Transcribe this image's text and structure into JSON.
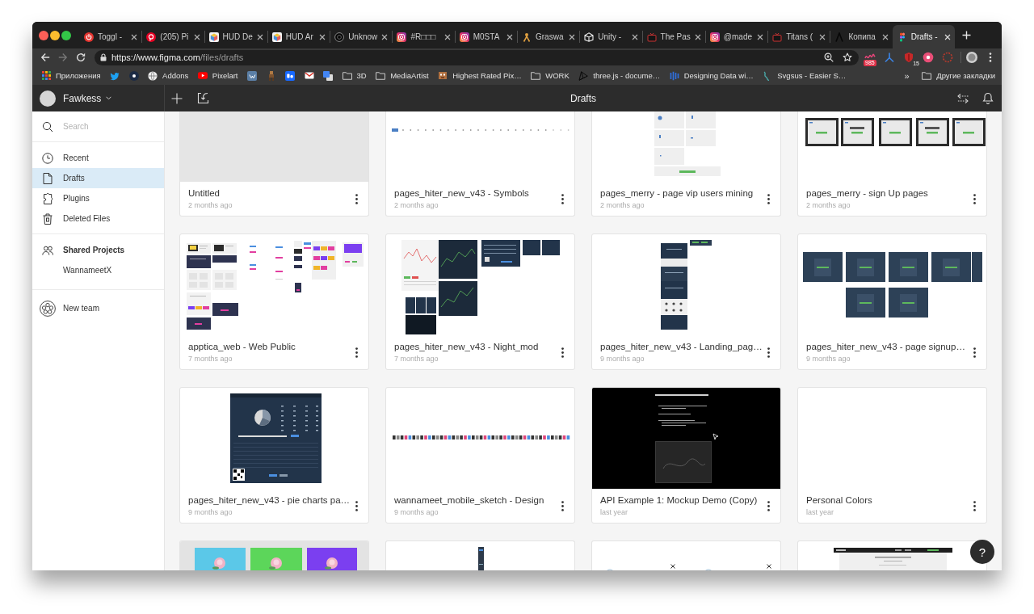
{
  "browser": {
    "tabs": [
      {
        "label": "Toggl -",
        "kind": "power",
        "selected": false
      },
      {
        "label": "(205) Pi",
        "kind": "pin",
        "selected": false
      },
      {
        "label": "HUD De",
        "kind": "cube",
        "selected": false
      },
      {
        "label": "HUD Ar",
        "kind": "cube",
        "selected": false
      },
      {
        "label": "Unknow",
        "kind": "ring",
        "selected": false
      },
      {
        "label": "#R□□□",
        "kind": "camera",
        "selected": false
      },
      {
        "label": "M0STA",
        "kind": "camera",
        "selected": false
      },
      {
        "label": "Graswa",
        "kind": "figure",
        "selected": false
      },
      {
        "label": "Unity -",
        "kind": "outline",
        "selected": false
      },
      {
        "label": "The Pas",
        "kind": "tv",
        "selected": false
      },
      {
        "label": "@made",
        "kind": "camera",
        "selected": false
      },
      {
        "label": "Titans (",
        "kind": "tv",
        "selected": false
      },
      {
        "label": "Копипа",
        "kind": "chevron",
        "selected": false
      },
      {
        "label": "Drafts -",
        "kind": "blocks",
        "selected": true
      }
    ],
    "nav_buttons": [
      {
        "kind": "back",
        "disabled": false
      },
      {
        "kind": "forward",
        "disabled": true
      },
      {
        "kind": "reload",
        "disabled": false
      }
    ],
    "address": {
      "host": "https://www.figma.com",
      "path": "/files/drafts"
    },
    "extensions": [
      {
        "kind": "scribble",
        "badge": "985"
      },
      {
        "kind": "fork"
      },
      {
        "kind": "shield",
        "badge": "15"
      },
      {
        "kind": "round"
      },
      {
        "kind": "ring"
      }
    ],
    "bookmarks": [
      {
        "kind": "apps",
        "label": "Приложения"
      },
      {
        "kind": "bird"
      },
      {
        "kind": "circle"
      },
      {
        "kind": "globe",
        "label": "Addons"
      },
      {
        "kind": "play",
        "label": "Pixelart"
      },
      {
        "kind": "slate"
      },
      {
        "kind": "figure"
      },
      {
        "kind": "tile"
      },
      {
        "kind": "envelope"
      },
      {
        "kind": "squares"
      },
      {
        "kind": "folder",
        "label": "3D"
      },
      {
        "kind": "folder",
        "label": "MediaArtist"
      },
      {
        "kind": "pixel",
        "label": "Highest Rated Pix…"
      },
      {
        "kind": "folder",
        "label": "WORK"
      },
      {
        "kind": "triangle",
        "label": "three.js - docume…"
      },
      {
        "kind": "bars",
        "label": "Designing Data wi…"
      },
      {
        "kind": "squiggle",
        "label": "Svgsus - Easier S…"
      }
    ],
    "bookmarks_more": "»",
    "other_bookmarks": {
      "kind": "folder",
      "label": "Другие закладки"
    }
  },
  "app": {
    "team": "Fawkess",
    "title": "Drafts",
    "search": {
      "placeholder": "Search"
    },
    "nav": [
      {
        "kind": "clock",
        "label": "Recent",
        "selected": false
      },
      {
        "kind": "file",
        "label": "Drafts",
        "selected": true
      },
      {
        "kind": "puzzle",
        "label": "Plugins",
        "selected": false
      },
      {
        "kind": "trash",
        "label": "Deleted Files",
        "selected": false
      }
    ],
    "shared_projects": {
      "label": "Shared Projects",
      "projects": [
        {
          "label": "WannameetX",
          "selected": false
        }
      ]
    },
    "new_team": "New team",
    "files": [
      {
        "title": "Untitled",
        "time": "2 months ago",
        "kind": "empty"
      },
      {
        "title": "pages_hiter_new_v43 - Symbols",
        "time": "2 months ago",
        "kind": "dots"
      },
      {
        "title": "pages_merry - page vip users mining",
        "time": "2 months ago",
        "kind": "tiles"
      },
      {
        "title": "pages_merry - sign Up pages",
        "time": "2 months ago",
        "kind": "frames"
      },
      {
        "title": "apptica_web - Web Public",
        "time": "7 months ago",
        "kind": "board"
      },
      {
        "title": "pages_hiter_new_v43 - Night_mod",
        "time": "7 months ago",
        "kind": "dashboards"
      },
      {
        "title": "pages_hiter_new_v43 - Landing_pag…",
        "time": "9 months ago",
        "kind": "column"
      },
      {
        "title": "pages_hiter_new_v43 - page signup…",
        "time": "9 months ago",
        "kind": "screens"
      },
      {
        "title": "pages_hiter_new_v43 - pie charts pa…",
        "time": "9 months ago",
        "kind": "report"
      },
      {
        "title": "wannameet_mobile_sketch - Design",
        "time": "9 months ago",
        "kind": "icons"
      },
      {
        "title": "API Example 1: Mockup Demo (Copy)",
        "time": "last year",
        "kind": "demo"
      },
      {
        "title": "Personal Colors",
        "time": "last year",
        "kind": "blank"
      },
      {
        "kind": "swatches"
      },
      {
        "kind": "strip"
      },
      {
        "kind": "marks"
      },
      {
        "kind": "header"
      }
    ],
    "help": "?"
  }
}
